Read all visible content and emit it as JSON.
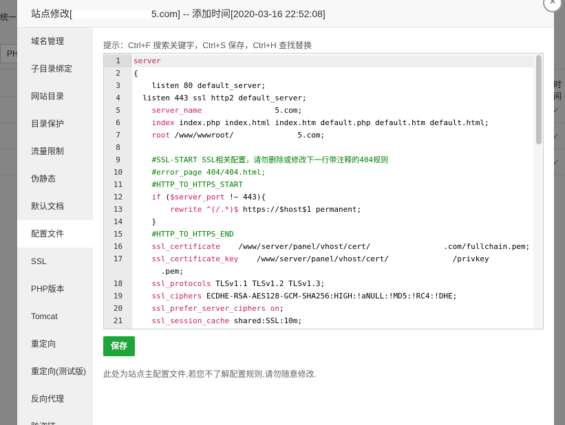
{
  "background": {
    "left_text": "统一",
    "left_input": "PH",
    "right_text": "时间"
  },
  "modal": {
    "title_prefix": "站点修改[",
    "title_suffix": "5.com] -- 添加时间[2020-03-16 22:52:08]",
    "close_symbol": "×"
  },
  "sidebar": {
    "items": [
      {
        "label": "域名管理"
      },
      {
        "label": "子目录绑定"
      },
      {
        "label": "网站目录"
      },
      {
        "label": "目录保护"
      },
      {
        "label": "流量限制"
      },
      {
        "label": "伪静态"
      },
      {
        "label": "默认文档"
      },
      {
        "label": "配置文件"
      },
      {
        "label": "SSL"
      },
      {
        "label": "PHP版本"
      },
      {
        "label": "Tomcat"
      },
      {
        "label": "重定向"
      },
      {
        "label": "重定向(测试版)"
      },
      {
        "label": "反向代理"
      },
      {
        "label": "防盗链"
      }
    ],
    "active_index": 7
  },
  "editor": {
    "tip": "提示：Ctrl+F 搜索关键字，Ctrl+S 保存，Ctrl+H 查找替换",
    "lines": [
      {
        "n": "1",
        "t": "server"
      },
      {
        "n": "2",
        "t": "{"
      },
      {
        "n": "3",
        "t": "    listen 80 default_server;"
      },
      {
        "n": "4",
        "t": "  listen 443 ssl http2 default_server;"
      },
      {
        "n": "5",
        "t": "    server_name                5.com;"
      },
      {
        "n": "6",
        "t": "    index index.php index.html index.htm default.php default.htm default.html;"
      },
      {
        "n": "7",
        "t": "    root /www/wwwroot/              5.com;"
      },
      {
        "n": "8",
        "t": ""
      },
      {
        "n": "9",
        "t": "    #SSL-START SSL相关配置，请勿删除或修改下一行带注释的404规则"
      },
      {
        "n": "10",
        "t": "    #error_page 404/404.html;"
      },
      {
        "n": "11",
        "t": "    #HTTP_TO_HTTPS_START"
      },
      {
        "n": "12",
        "t": "    if ($server_port !~ 443){"
      },
      {
        "n": "13",
        "t": "        rewrite ^(/.*)$ https://$host$1 permanent;"
      },
      {
        "n": "14",
        "t": "    }"
      },
      {
        "n": "15",
        "t": "    #HTTP_TO_HTTPS_END"
      },
      {
        "n": "16",
        "t": "    ssl_certificate    /www/server/panel/vhost/cert/                .com/fullchain.pem;"
      },
      {
        "n": "17",
        "t": "    ssl_certificate_key    /www/server/panel/vhost/cert/              /privkey"
      },
      {
        "n": "",
        "t": "      .pem;"
      },
      {
        "n": "18",
        "t": "    ssl_protocols TLSv1.1 TLSv1.2 TLSv1.3;"
      },
      {
        "n": "19",
        "t": "    ssl_ciphers ECDHE-RSA-AES128-GCM-SHA256:HIGH:!aNULL:!MD5:!RC4:!DHE;"
      },
      {
        "n": "20",
        "t": "    ssl_prefer_server_ciphers on;"
      },
      {
        "n": "21",
        "t": "    ssl_session_cache shared:SSL:10m;"
      }
    ]
  },
  "save_label": "保存",
  "note": "此处为站点主配置文件,若您不了解配置规则,请勿随意修改."
}
